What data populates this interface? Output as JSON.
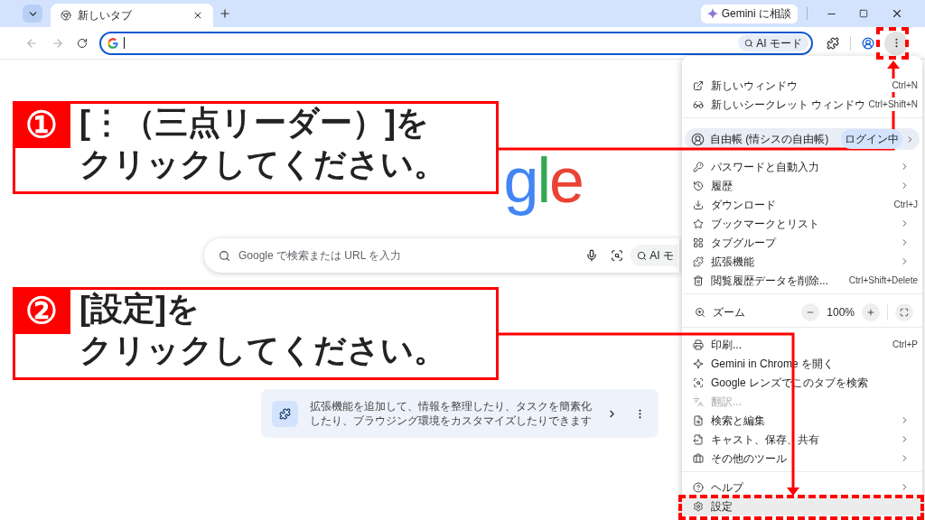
{
  "tab_strip": {
    "tab": {
      "title": "新しいタブ"
    },
    "gemini_button": "Gemini に相談"
  },
  "toolbar": {
    "omnibox": {
      "ai_mode_chip": "AI モード"
    }
  },
  "new_tab_page": {
    "logo": "gle",
    "search": {
      "placeholder": "Google で検索または URL を入力",
      "ai_mode_chip": "AI モ"
    },
    "extension_card": {
      "text": "拡張機能を追加して、情報を整理したり、タスクを簡素化したり、ブラウジング環境をカスタマイズしたりできます"
    }
  },
  "menu": {
    "sections": [
      [
        {
          "kind": "item",
          "label": "新しいウィンドウ",
          "shortcut": "Ctrl+N",
          "submenu": false,
          "disabled": false,
          "selected": false
        },
        {
          "kind": "item",
          "label": "新しいシークレット ウィンドウ",
          "shortcut": "Ctrl+Shift+N",
          "submenu": false,
          "disabled": false,
          "selected": false
        }
      ],
      [
        {
          "kind": "profile",
          "label": "自由帳 (情シスの自由帳)",
          "badge": "ログイン中",
          "submenu": true
        }
      ],
      [
        {
          "kind": "item",
          "label": "パスワードと自動入力",
          "submenu": true,
          "disabled": false,
          "selected": false
        },
        {
          "kind": "item",
          "label": "履歴",
          "submenu": true,
          "disabled": false,
          "selected": false
        },
        {
          "kind": "item",
          "label": "ダウンロード",
          "shortcut": "Ctrl+J",
          "submenu": false,
          "disabled": false,
          "selected": false
        },
        {
          "kind": "item",
          "label": "ブックマークとリスト",
          "submenu": true,
          "disabled": false,
          "selected": false
        },
        {
          "kind": "item",
          "label": "タブグループ",
          "submenu": true,
          "disabled": false,
          "selected": false
        },
        {
          "kind": "item",
          "label": "拡張機能",
          "submenu": true,
          "disabled": false,
          "selected": false
        },
        {
          "kind": "item",
          "label": "閲覧履歴データを削除...",
          "shortcut": "Ctrl+Shift+Delete",
          "submenu": false,
          "disabled": false,
          "selected": false
        }
      ],
      [
        {
          "kind": "zoom",
          "label": "ズーム",
          "value": "100%"
        }
      ],
      [
        {
          "kind": "item",
          "label": "印刷...",
          "shortcut": "Ctrl+P",
          "submenu": false,
          "disabled": false,
          "selected": false
        },
        {
          "kind": "item",
          "label": "Gemini in Chrome を開く",
          "submenu": false,
          "disabled": false,
          "selected": false
        },
        {
          "kind": "item",
          "label": "Google レンズでこのタブを検索",
          "submenu": false,
          "disabled": false,
          "selected": false
        },
        {
          "kind": "item",
          "label": "翻訳...",
          "submenu": false,
          "disabled": true,
          "selected": false
        },
        {
          "kind": "item",
          "label": "検索と編集",
          "submenu": true,
          "disabled": false,
          "selected": false
        },
        {
          "kind": "item",
          "label": "キャスト、保存、共有",
          "submenu": true,
          "disabled": false,
          "selected": false
        },
        {
          "kind": "item",
          "label": "その他のツール",
          "submenu": true,
          "disabled": false,
          "selected": false
        }
      ],
      [
        {
          "kind": "item",
          "label": "ヘルプ",
          "submenu": true,
          "disabled": false,
          "selected": false
        },
        {
          "kind": "item",
          "label": "設定",
          "submenu": false,
          "disabled": false,
          "selected": true
        }
      ]
    ]
  },
  "annotations": [
    {
      "number": "①",
      "lines": [
        "[⋮（三点リーダー）]を",
        "クリックしてください。"
      ]
    },
    {
      "number": "②",
      "lines": [
        "[設定]を",
        "クリックしてください。"
      ]
    }
  ]
}
